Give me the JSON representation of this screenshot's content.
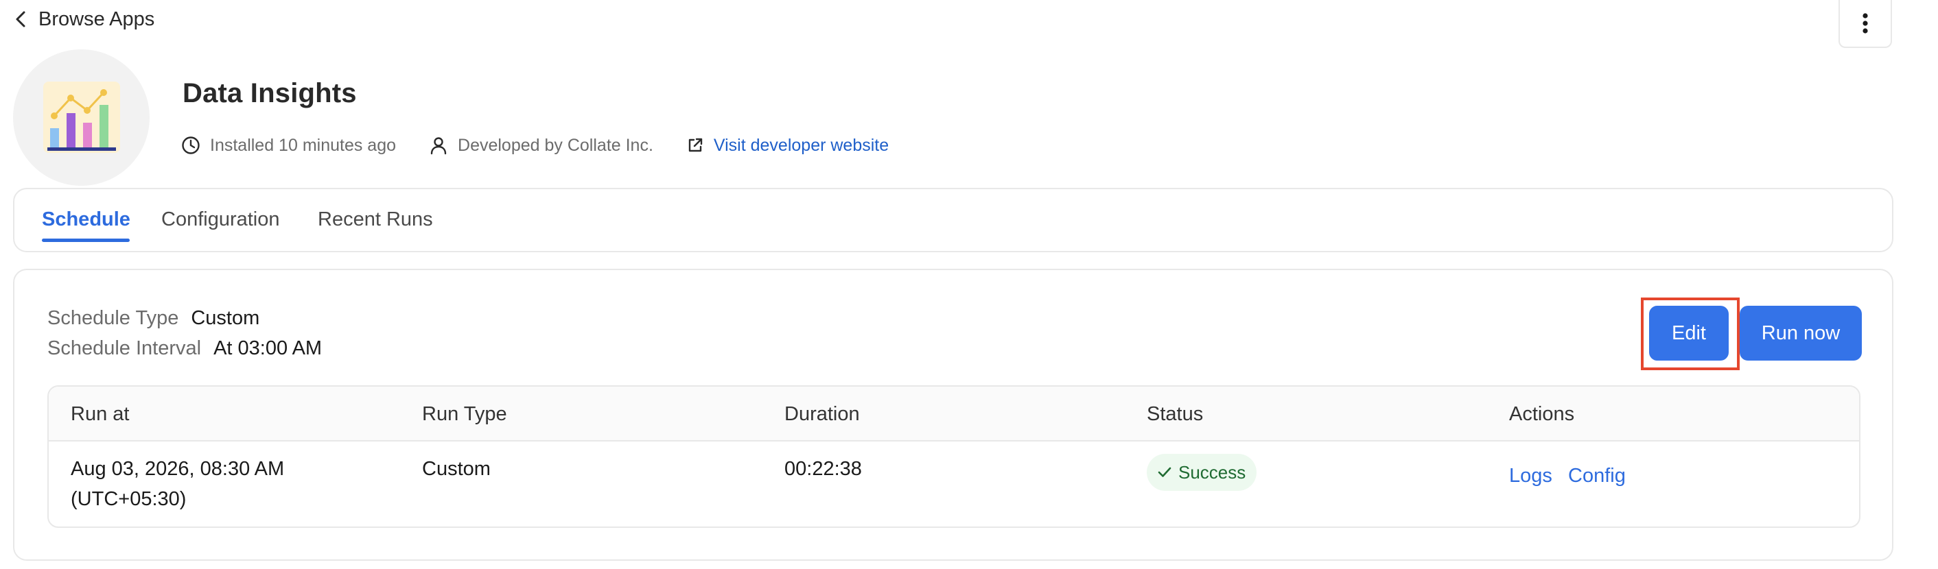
{
  "header": {
    "back_label": "Browse Apps"
  },
  "app": {
    "title": "Data Insights",
    "installed": "Installed 10 minutes ago",
    "developer": "Developed by Collate Inc.",
    "website_link": "Visit developer website"
  },
  "tabs": [
    {
      "label": "Schedule",
      "active": true
    },
    {
      "label": "Configuration",
      "active": false
    },
    {
      "label": "Recent Runs",
      "active": false
    }
  ],
  "schedule": {
    "type_label": "Schedule Type",
    "type_value": "Custom",
    "interval_label": "Schedule Interval",
    "interval_value": "At 03:00 AM",
    "edit_label": "Edit",
    "run_now_label": "Run now"
  },
  "table": {
    "columns": [
      "Run at",
      "Run Type",
      "Duration",
      "Status",
      "Actions"
    ],
    "rows": [
      {
        "run_at_line1": "Aug 03, 2026, 08:30 AM",
        "run_at_line2": "(UTC+05:30)",
        "run_type": "Custom",
        "duration": "00:22:38",
        "status": "Success",
        "actions": [
          "Logs",
          "Config"
        ]
      }
    ]
  },
  "colors": {
    "primary": "#3473e8",
    "link": "#2d6bde",
    "success_bg": "#edf9ef",
    "success_text": "#1f6b32",
    "highlight": "#e5472e"
  },
  "icons": {
    "back": "chevron-left-icon",
    "menu": "kebab-menu-icon",
    "app": "bar-chart-app-icon",
    "installed": "clock-icon",
    "developer": "user-icon",
    "website": "external-link-icon",
    "status": "check-icon"
  }
}
